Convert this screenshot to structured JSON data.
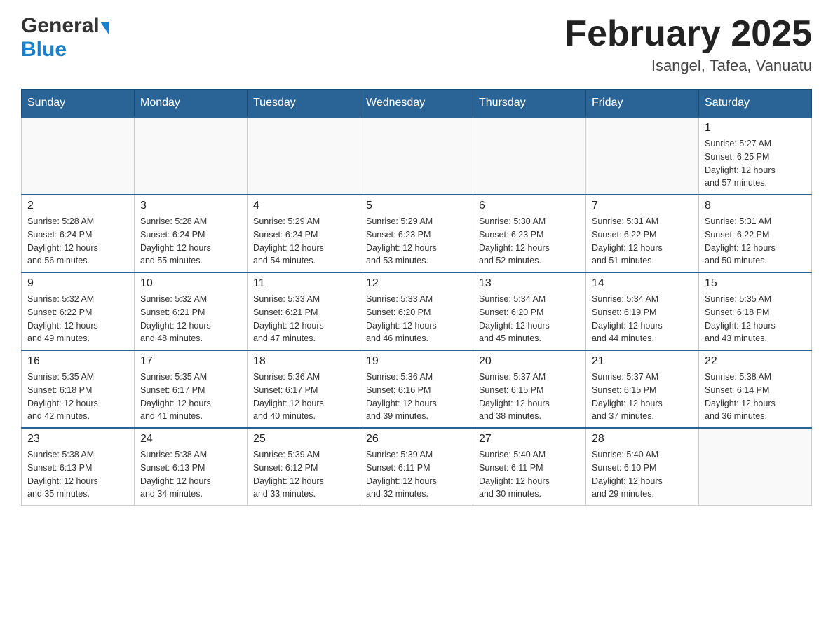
{
  "header": {
    "logo_general": "General",
    "logo_blue": "Blue",
    "month_title": "February 2025",
    "location": "Isangel, Tafea, Vanuatu"
  },
  "days_of_week": [
    "Sunday",
    "Monday",
    "Tuesday",
    "Wednesday",
    "Thursday",
    "Friday",
    "Saturday"
  ],
  "weeks": [
    [
      {
        "day": "",
        "info": ""
      },
      {
        "day": "",
        "info": ""
      },
      {
        "day": "",
        "info": ""
      },
      {
        "day": "",
        "info": ""
      },
      {
        "day": "",
        "info": ""
      },
      {
        "day": "",
        "info": ""
      },
      {
        "day": "1",
        "info": "Sunrise: 5:27 AM\nSunset: 6:25 PM\nDaylight: 12 hours\nand 57 minutes."
      }
    ],
    [
      {
        "day": "2",
        "info": "Sunrise: 5:28 AM\nSunset: 6:24 PM\nDaylight: 12 hours\nand 56 minutes."
      },
      {
        "day": "3",
        "info": "Sunrise: 5:28 AM\nSunset: 6:24 PM\nDaylight: 12 hours\nand 55 minutes."
      },
      {
        "day": "4",
        "info": "Sunrise: 5:29 AM\nSunset: 6:24 PM\nDaylight: 12 hours\nand 54 minutes."
      },
      {
        "day": "5",
        "info": "Sunrise: 5:29 AM\nSunset: 6:23 PM\nDaylight: 12 hours\nand 53 minutes."
      },
      {
        "day": "6",
        "info": "Sunrise: 5:30 AM\nSunset: 6:23 PM\nDaylight: 12 hours\nand 52 minutes."
      },
      {
        "day": "7",
        "info": "Sunrise: 5:31 AM\nSunset: 6:22 PM\nDaylight: 12 hours\nand 51 minutes."
      },
      {
        "day": "8",
        "info": "Sunrise: 5:31 AM\nSunset: 6:22 PM\nDaylight: 12 hours\nand 50 minutes."
      }
    ],
    [
      {
        "day": "9",
        "info": "Sunrise: 5:32 AM\nSunset: 6:22 PM\nDaylight: 12 hours\nand 49 minutes."
      },
      {
        "day": "10",
        "info": "Sunrise: 5:32 AM\nSunset: 6:21 PM\nDaylight: 12 hours\nand 48 minutes."
      },
      {
        "day": "11",
        "info": "Sunrise: 5:33 AM\nSunset: 6:21 PM\nDaylight: 12 hours\nand 47 minutes."
      },
      {
        "day": "12",
        "info": "Sunrise: 5:33 AM\nSunset: 6:20 PM\nDaylight: 12 hours\nand 46 minutes."
      },
      {
        "day": "13",
        "info": "Sunrise: 5:34 AM\nSunset: 6:20 PM\nDaylight: 12 hours\nand 45 minutes."
      },
      {
        "day": "14",
        "info": "Sunrise: 5:34 AM\nSunset: 6:19 PM\nDaylight: 12 hours\nand 44 minutes."
      },
      {
        "day": "15",
        "info": "Sunrise: 5:35 AM\nSunset: 6:18 PM\nDaylight: 12 hours\nand 43 minutes."
      }
    ],
    [
      {
        "day": "16",
        "info": "Sunrise: 5:35 AM\nSunset: 6:18 PM\nDaylight: 12 hours\nand 42 minutes."
      },
      {
        "day": "17",
        "info": "Sunrise: 5:35 AM\nSunset: 6:17 PM\nDaylight: 12 hours\nand 41 minutes."
      },
      {
        "day": "18",
        "info": "Sunrise: 5:36 AM\nSunset: 6:17 PM\nDaylight: 12 hours\nand 40 minutes."
      },
      {
        "day": "19",
        "info": "Sunrise: 5:36 AM\nSunset: 6:16 PM\nDaylight: 12 hours\nand 39 minutes."
      },
      {
        "day": "20",
        "info": "Sunrise: 5:37 AM\nSunset: 6:15 PM\nDaylight: 12 hours\nand 38 minutes."
      },
      {
        "day": "21",
        "info": "Sunrise: 5:37 AM\nSunset: 6:15 PM\nDaylight: 12 hours\nand 37 minutes."
      },
      {
        "day": "22",
        "info": "Sunrise: 5:38 AM\nSunset: 6:14 PM\nDaylight: 12 hours\nand 36 minutes."
      }
    ],
    [
      {
        "day": "23",
        "info": "Sunrise: 5:38 AM\nSunset: 6:13 PM\nDaylight: 12 hours\nand 35 minutes."
      },
      {
        "day": "24",
        "info": "Sunrise: 5:38 AM\nSunset: 6:13 PM\nDaylight: 12 hours\nand 34 minutes."
      },
      {
        "day": "25",
        "info": "Sunrise: 5:39 AM\nSunset: 6:12 PM\nDaylight: 12 hours\nand 33 minutes."
      },
      {
        "day": "26",
        "info": "Sunrise: 5:39 AM\nSunset: 6:11 PM\nDaylight: 12 hours\nand 32 minutes."
      },
      {
        "day": "27",
        "info": "Sunrise: 5:40 AM\nSunset: 6:11 PM\nDaylight: 12 hours\nand 30 minutes."
      },
      {
        "day": "28",
        "info": "Sunrise: 5:40 AM\nSunset: 6:10 PM\nDaylight: 12 hours\nand 29 minutes."
      },
      {
        "day": "",
        "info": ""
      }
    ]
  ]
}
